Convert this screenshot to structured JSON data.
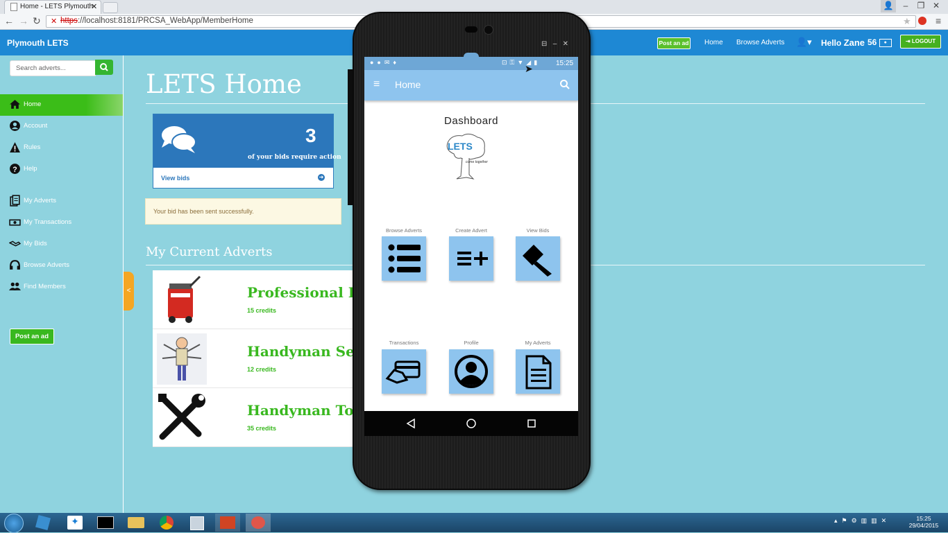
{
  "browser": {
    "tab_title": "Home - LETS Plymouth",
    "url_scheme": "https",
    "url_rest": "://localhost:8181/PRCSA_WebApp/MemberHome"
  },
  "header": {
    "brand": "Plymouth LETS",
    "post_ad": "Post an ad",
    "home": "Home",
    "browse": "Browse Adverts",
    "hello": "Hello",
    "user": "Zane",
    "credits": "56",
    "logout": "LOGOUT"
  },
  "sidebar": {
    "search_placeholder": "Search adverts...",
    "items": [
      {
        "label": "Home",
        "icon": "home-icon"
      },
      {
        "label": "Account",
        "icon": "user-circle-icon"
      },
      {
        "label": "Rules",
        "icon": "warning-icon"
      },
      {
        "label": "Help",
        "icon": "question-icon"
      },
      {
        "label": "My Adverts",
        "icon": "documents-icon"
      },
      {
        "label": "My Transactions",
        "icon": "money-icon"
      },
      {
        "label": "My Bids",
        "icon": "handshake-icon"
      },
      {
        "label": "Browse Adverts",
        "icon": "headset-icon"
      },
      {
        "label": "Find Members",
        "icon": "users-icon"
      }
    ],
    "post_ad": "Post an ad",
    "toggle": "<"
  },
  "main": {
    "title": "LETS Home",
    "bids_count": "3",
    "bids_text": "of your bids require action",
    "view_bids": "View bids",
    "alert": "Your bid has been sent successfully.",
    "adverts_heading": "My Current Adverts",
    "adverts": [
      {
        "title": "Professional Floo",
        "credits": "15 credits",
        "image": "carpet-cleaner-image"
      },
      {
        "title": "Handyman Servi",
        "credits": "12 credits",
        "image": "handyman-image"
      },
      {
        "title": "Handyman Tools",
        "credits": "35 credits",
        "image": "tools-icon"
      }
    ]
  },
  "phone": {
    "time": "15:25",
    "app_title": "Home",
    "dashboard": "Dashboard",
    "logo_text": "LETS",
    "logo_tagline": "come together",
    "tiles": [
      {
        "label": "Browse Adverts",
        "icon": "list-icon"
      },
      {
        "label": "Create Advert",
        "icon": "add-list-icon"
      },
      {
        "label": "View Bids",
        "icon": "gavel-icon"
      },
      {
        "label": "Transactions",
        "icon": "card-icon"
      },
      {
        "label": "Profile",
        "icon": "profile-icon"
      },
      {
        "label": "My Adverts",
        "icon": "document-icon"
      }
    ]
  },
  "taskbar": {
    "time": "15:25",
    "date": "29/04/2015"
  },
  "colors": {
    "page_bg": "#8fd3df",
    "header_blue": "#1e88d4",
    "accent_green": "#39b81f",
    "phone_accent": "#8ec4ee"
  }
}
